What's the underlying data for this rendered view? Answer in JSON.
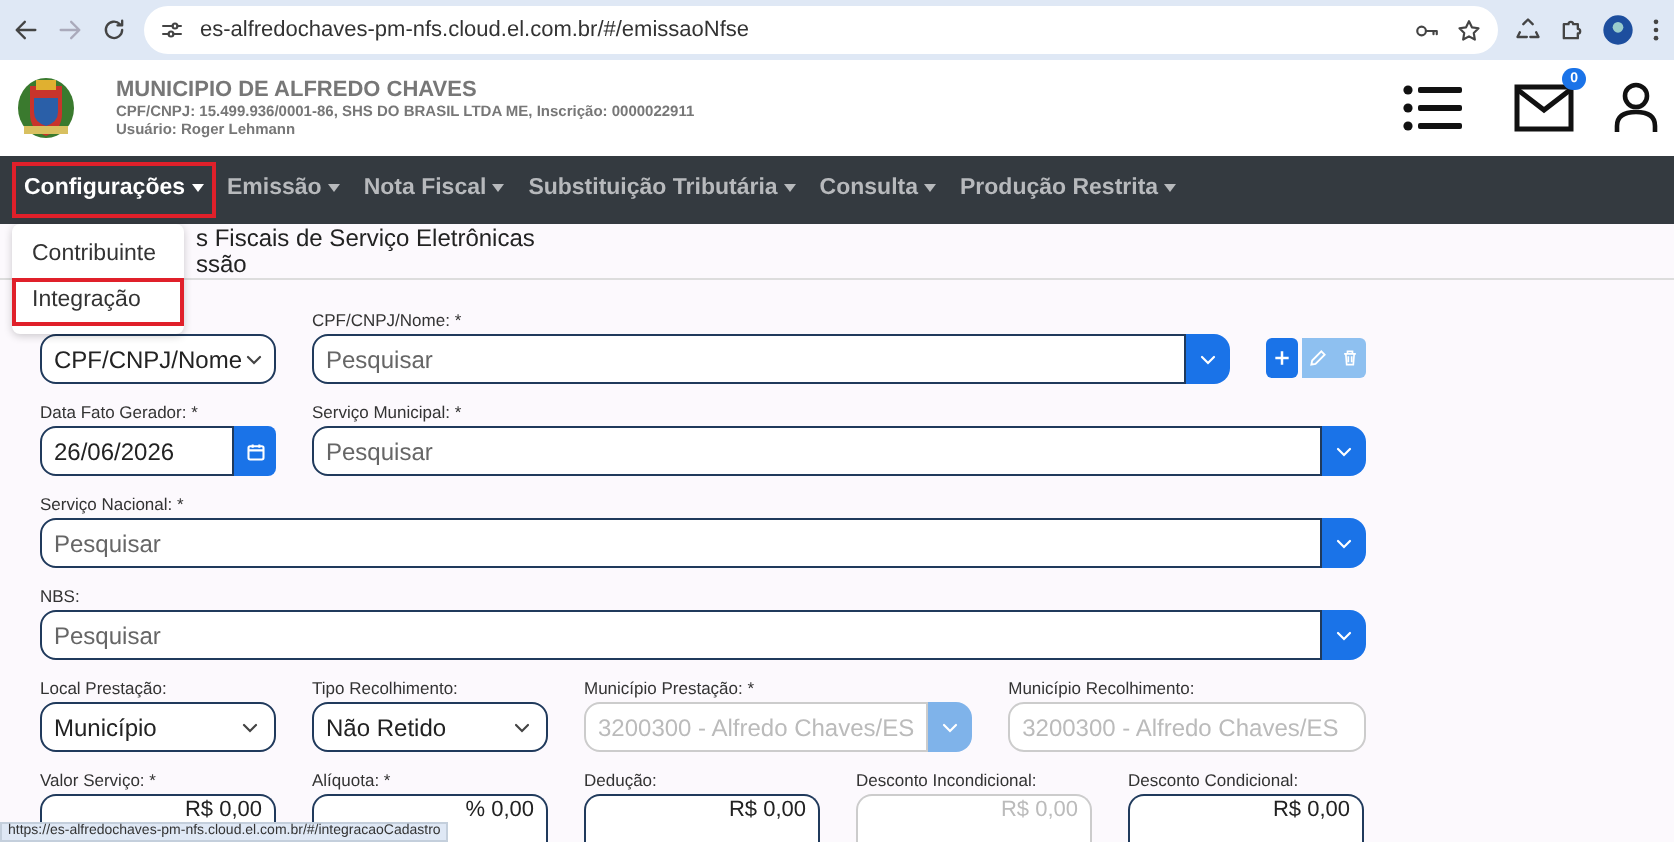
{
  "browser": {
    "address": "es-alfredochaves-pm-nfs.cloud.el.com.br/#/emissaoNfse",
    "forward_disabled": true
  },
  "header": {
    "title": "MUNICIPIO DE ALFREDO CHAVES",
    "company": "CPF/CNPJ: 15.499.936/0001-86, SHS DO BRASIL LTDA ME, Inscrição: 0000022911",
    "user": "Usuário: Roger Lehmann",
    "mail_count": "0"
  },
  "nav": [
    {
      "label": "Configurações",
      "highlighted": true,
      "open": true,
      "menu": [
        {
          "label": "Contribuinte",
          "highlighted": false
        },
        {
          "label": "Integração",
          "highlighted": true
        }
      ]
    },
    {
      "label": "Emissão",
      "highlighted": false,
      "open": false
    },
    {
      "label": "Nota Fiscal",
      "highlighted": false,
      "open": false
    },
    {
      "label": "Substituição Tributária",
      "highlighted": false,
      "open": false
    },
    {
      "label": "Consulta",
      "highlighted": false,
      "open": false
    },
    {
      "label": "Produção Restrita",
      "highlighted": false,
      "open": false
    }
  ],
  "page_title": [
    "s Fiscais de Serviço Eletrônicas",
    "ssão"
  ],
  "form": [
    [
      {
        "kind": "select",
        "value": "CPF/CNPJ/Nome"
      },
      {
        "kind": "lookup",
        "label": "CPF/CNPJ/Nome: *",
        "placeholder": "Pesquisar",
        "disabled": false
      },
      {
        "kind": "actions",
        "buttons": [
          {
            "disabled": false
          },
          {
            "disabled": true
          },
          {
            "disabled": true
          }
        ]
      }
    ],
    [
      {
        "kind": "date",
        "label": "Data Fato Gerador: *",
        "value": "26/06/2026"
      },
      {
        "kind": "lookup",
        "label": "Serviço Municipal: *",
        "placeholder": "Pesquisar",
        "disabled": false
      }
    ],
    [
      {
        "kind": "lookup",
        "label": "Serviço Nacional: *",
        "placeholder": "Pesquisar",
        "disabled": false
      }
    ],
    [
      {
        "kind": "lookup",
        "label": "NBS:",
        "placeholder": "Pesquisar",
        "disabled": false
      }
    ],
    [
      {
        "kind": "select",
        "label": "Local Prestação:",
        "value": "Município"
      },
      {
        "kind": "select",
        "label": "Tipo Recolhimento:",
        "value": "Não Retido"
      },
      {
        "kind": "lookup",
        "label": "Município Prestação: *",
        "value": "3200300 - Alfredo Chaves/ES",
        "disabled": true
      },
      {
        "kind": "text",
        "label": "Município Recolhimento:",
        "value": "3200300 - Alfredo Chaves/ES",
        "disabled": true
      }
    ],
    [
      {
        "kind": "money",
        "label": "Valor Serviço: *",
        "value": "R$ 0,00",
        "disabled": false
      },
      {
        "kind": "money",
        "label": "Alíquota: *",
        "value": "% 0,00",
        "disabled": false
      },
      {
        "kind": "money",
        "label": "Dedução:",
        "value": "R$ 0,00",
        "disabled": false
      },
      {
        "kind": "money",
        "label": "Desconto Incondicional:",
        "value": "R$ 0,00",
        "disabled": true
      },
      {
        "kind": "money",
        "label": "Desconto Condicional:",
        "value": "R$ 0,00",
        "disabled": false
      }
    ]
  ],
  "status_url": "https://es-alfredochaves-pm-nfs.cloud.el.com.br/#/integracaoCadastro"
}
